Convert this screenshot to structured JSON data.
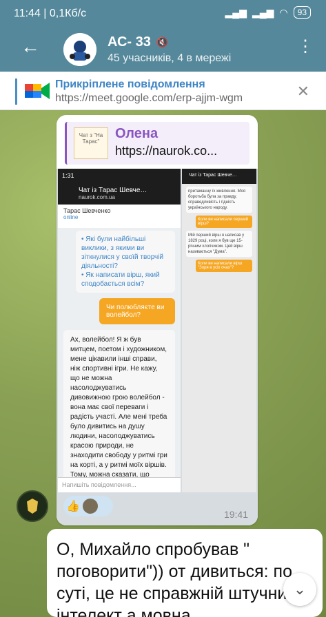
{
  "status": {
    "time": "11:44 | 0,1Кб/с",
    "battery": "93"
  },
  "header": {
    "title": "АС- 33",
    "subtitle": "45 учасників, 4 в мережі"
  },
  "pinned": {
    "title": "Прикріплене повідомлення",
    "url": "https://meet.google.com/erp-ajjm-wgm"
  },
  "photo_message": {
    "reply_name": "Олена",
    "reply_text": "https://naurok.co...",
    "reply_thumb_text": "Чат з \"На Тарас\"",
    "time": "19:41",
    "screenshot": {
      "phone_time": "1:31",
      "chat_title": "Чат із Тарас Шевче…",
      "chat_site": "naurok.com.ua",
      "name_line": "Тарас Шевченко",
      "status": "online",
      "bot_questions": "• Які були найбільші виклики, з якими ви зіткнулися у своїй творчій діяльності?\n• Як написати вірш, який сподобається всім?",
      "user_question": "Чи полюбляєте ви волейбол?",
      "reply": "Ах, волейбол! Я ж був митцем, поетом і художником, мене цікавили інші справи, ніж спортивні ігри. Не кажу, що не можна насолоджуватись дивовижною грою волейбол - вона має свої переваги і радість участі. Але мені треба було дивитись на душу людини, насолоджуватись красою природи, не знаходити свободу у ритмі гри на корті, а у ритмі моїх віршів. Тому, можна сказати, що волейбол не був моєю справою, моїм пасіонацією.",
      "input_placeholder": "Напишіть повідомлення...",
      "right_title": "Чат із Тарас Шевче…",
      "right_text_1": "притаманну їх живлення. Моя боротьба була за правду, справедливість і гідність українського народу.",
      "right_orange": "Коли ви написали перший вірш?",
      "right_text_2": "Мій перший вірш я написав у 1829 році, коли я був ще 15-річним хлопчиком. Цей вірш називається \"Дума\".",
      "right_orange_2": "Коли ви написали вірш \"Зоря в усіх очах\"?"
    }
  },
  "text_message": "О, Михайло спробував \" поговорити\")) от дивиться: по суті, це не справжній штучний інтелект а мовна"
}
